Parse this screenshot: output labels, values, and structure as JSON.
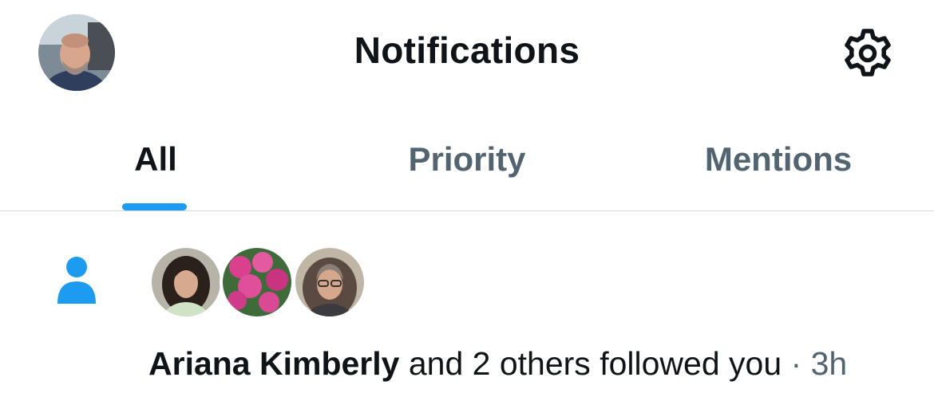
{
  "header": {
    "title": "Notifications",
    "profile_avatar": "profile-avatar",
    "settings_icon": "gear-icon"
  },
  "tabs": [
    {
      "label": "All",
      "active": true
    },
    {
      "label": "Priority",
      "active": false
    },
    {
      "label": "Mentions",
      "active": false
    }
  ],
  "notification": {
    "icon": "person-icon",
    "avatars": [
      "avatar-woman-curly-hair",
      "avatar-pink-flowers",
      "avatar-woman-glasses"
    ],
    "name": "Ariana Kimberly",
    "action": "and 2 others followed you",
    "separator": "·",
    "time": "3h"
  },
  "colors": {
    "accent": "#1d9bf0",
    "text_primary": "#0f1419",
    "text_secondary": "#536471",
    "divider": "#cfd9de"
  }
}
